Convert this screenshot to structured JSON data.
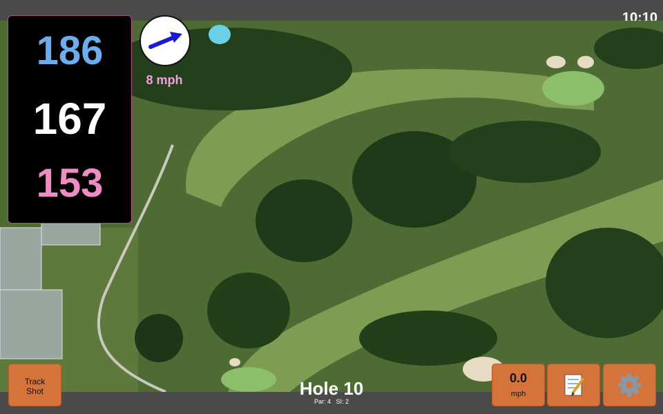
{
  "status": {
    "time": "10:10"
  },
  "distances": {
    "back": "186",
    "middle": "167",
    "front": "153"
  },
  "wind": {
    "speed": "8 mph",
    "icon": "wind-direction-arrow-icon"
  },
  "hole": {
    "title": "Hole 10",
    "par": "Par: 4",
    "si": "SI: 2"
  },
  "buttons": {
    "track_shot_line1": "Track",
    "track_shot_line2": "Shot",
    "speed_value": "0.0",
    "speed_unit": "mph",
    "notes_icon": "notepad-icon",
    "settings_icon": "gear-icon"
  },
  "colors": {
    "back": "#6aaef0",
    "middle": "#ffffff",
    "front": "#f08cc4",
    "button": "#d4733a",
    "wind_text": "#f79ee0"
  }
}
